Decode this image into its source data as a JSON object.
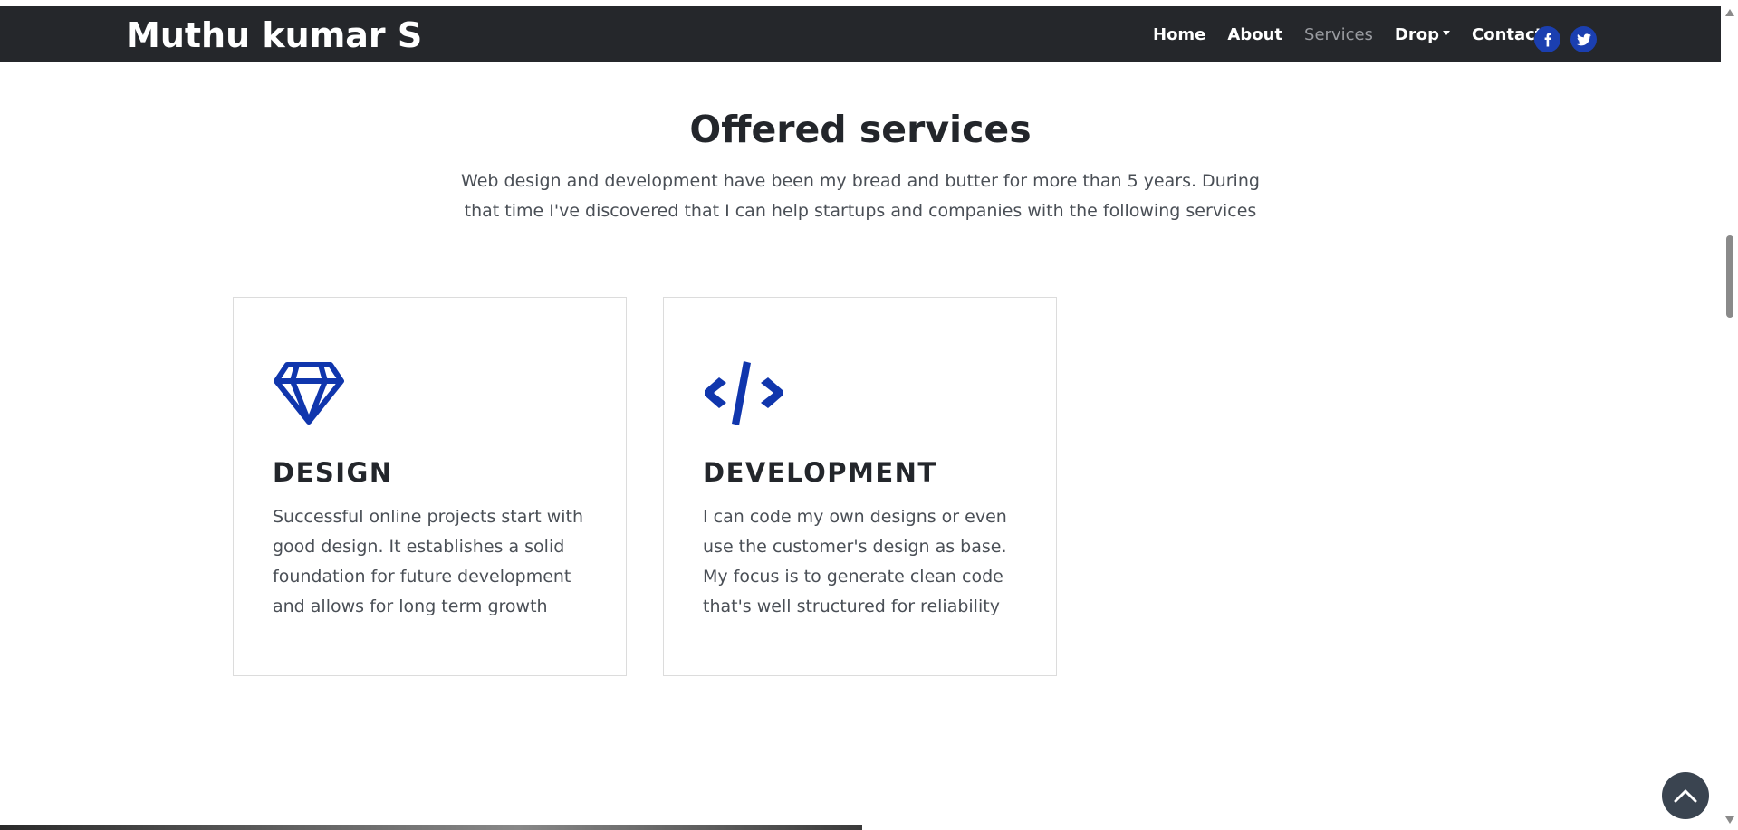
{
  "navbar": {
    "brand": "Muthu kumar S",
    "links": [
      {
        "label": "Home",
        "active": false
      },
      {
        "label": "About",
        "active": false
      },
      {
        "label": "Services",
        "active": true
      },
      {
        "label": "Drop",
        "active": false,
        "dropdown": true
      },
      {
        "label": "Contact",
        "active": false
      }
    ],
    "social": [
      {
        "icon": "facebook-icon"
      },
      {
        "icon": "twitter-icon"
      }
    ]
  },
  "services": {
    "title": "Offered services",
    "lead": "Web design and development have been my bread and butter for more than 5 years. During that time I've discovered that I can help startups and companies with the following services",
    "cards": [
      {
        "icon": "diamond-icon",
        "title": "DESIGN",
        "text": "Successful online projects start with good design. It establishes a solid foundation for future development and allows for long term growth"
      },
      {
        "icon": "code-icon",
        "title": "DEVELOPMENT",
        "text": "I can code my own designs or even use the customer's design as base. My focus is to generate clean code that's well structured for reliability"
      }
    ]
  },
  "colors": {
    "navbar_bg": "#25272b",
    "accent": "#1b3fb0",
    "heading": "#23262b",
    "body_text": "#4a4f56",
    "nav_active": "#9a9ca1"
  },
  "back_to_top": {
    "icon": "chevron-up-icon"
  }
}
